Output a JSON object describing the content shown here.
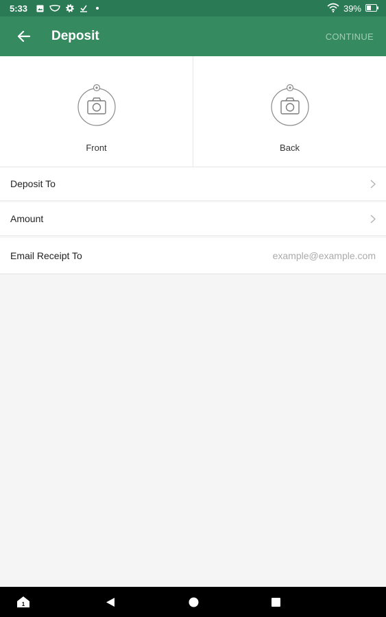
{
  "status_bar": {
    "time": "5:33",
    "battery": "39%",
    "icons": [
      "gallery-icon",
      "mask-icon",
      "gear-icon",
      "download-check-icon",
      "dot-icon",
      "wifi-icon",
      "battery-icon"
    ]
  },
  "app_bar": {
    "title": "Deposit",
    "continue_label": "CONTINUE",
    "color": "#358a60"
  },
  "capture": {
    "front_label": "Front",
    "back_label": "Back"
  },
  "rows": {
    "deposit_to": "Deposit To",
    "amount": "Amount",
    "email_receipt_to": "Email Receipt To",
    "email_placeholder": "example@example.com"
  },
  "nav_bar": {
    "icons": [
      "assistant-icon",
      "back-triangle-icon",
      "home-circle-icon",
      "recents-square-icon"
    ]
  }
}
